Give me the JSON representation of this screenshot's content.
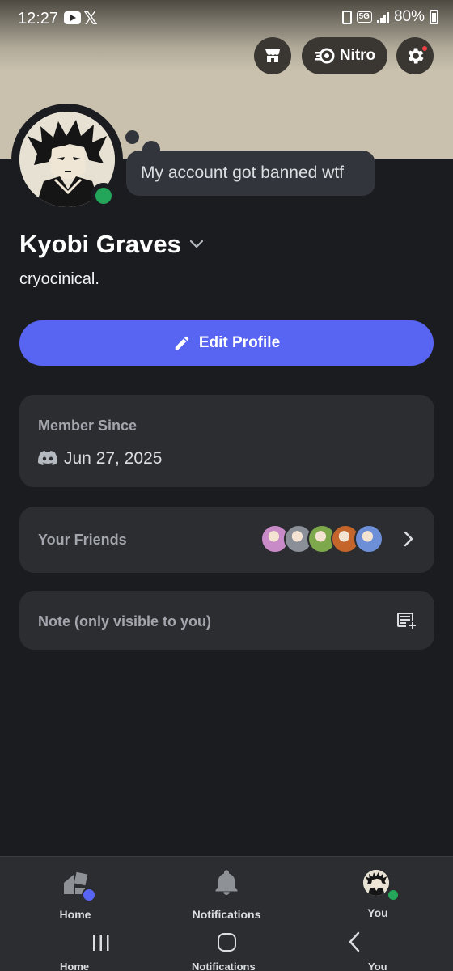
{
  "status_bar": {
    "time": "12:27",
    "network": "5G",
    "battery": "80%",
    "icons": [
      "youtube-icon",
      "x-icon",
      "battery-saver-icon",
      "signal-icon",
      "battery-icon"
    ]
  },
  "header": {
    "shop_icon": "shop-icon",
    "nitro_label": "Nitro",
    "settings_icon": "gear-icon",
    "settings_has_notification": true
  },
  "profile": {
    "custom_status": "My account got banned wtf",
    "display_name": "Kyobi Graves",
    "username": "cryocinical.",
    "presence": "online",
    "presence_color": "#23a55a"
  },
  "actions": {
    "edit_profile_label": "Edit Profile",
    "accent_color": "#5865f2"
  },
  "member_since": {
    "title": "Member Since",
    "date": "Jun 27, 2025"
  },
  "friends": {
    "title": "Your Friends",
    "avatar_colors": [
      "#c98ac8",
      "#8a8f98",
      "#7ea84c",
      "#c4652c",
      "#6d8fd8"
    ]
  },
  "note": {
    "placeholder": "Note (only visible to you)"
  },
  "bottom_nav": {
    "items": [
      {
        "label": "Home",
        "icon": "home-icon"
      },
      {
        "label": "Notifications",
        "icon": "bell-icon"
      },
      {
        "label": "You",
        "icon": "avatar"
      }
    ]
  }
}
